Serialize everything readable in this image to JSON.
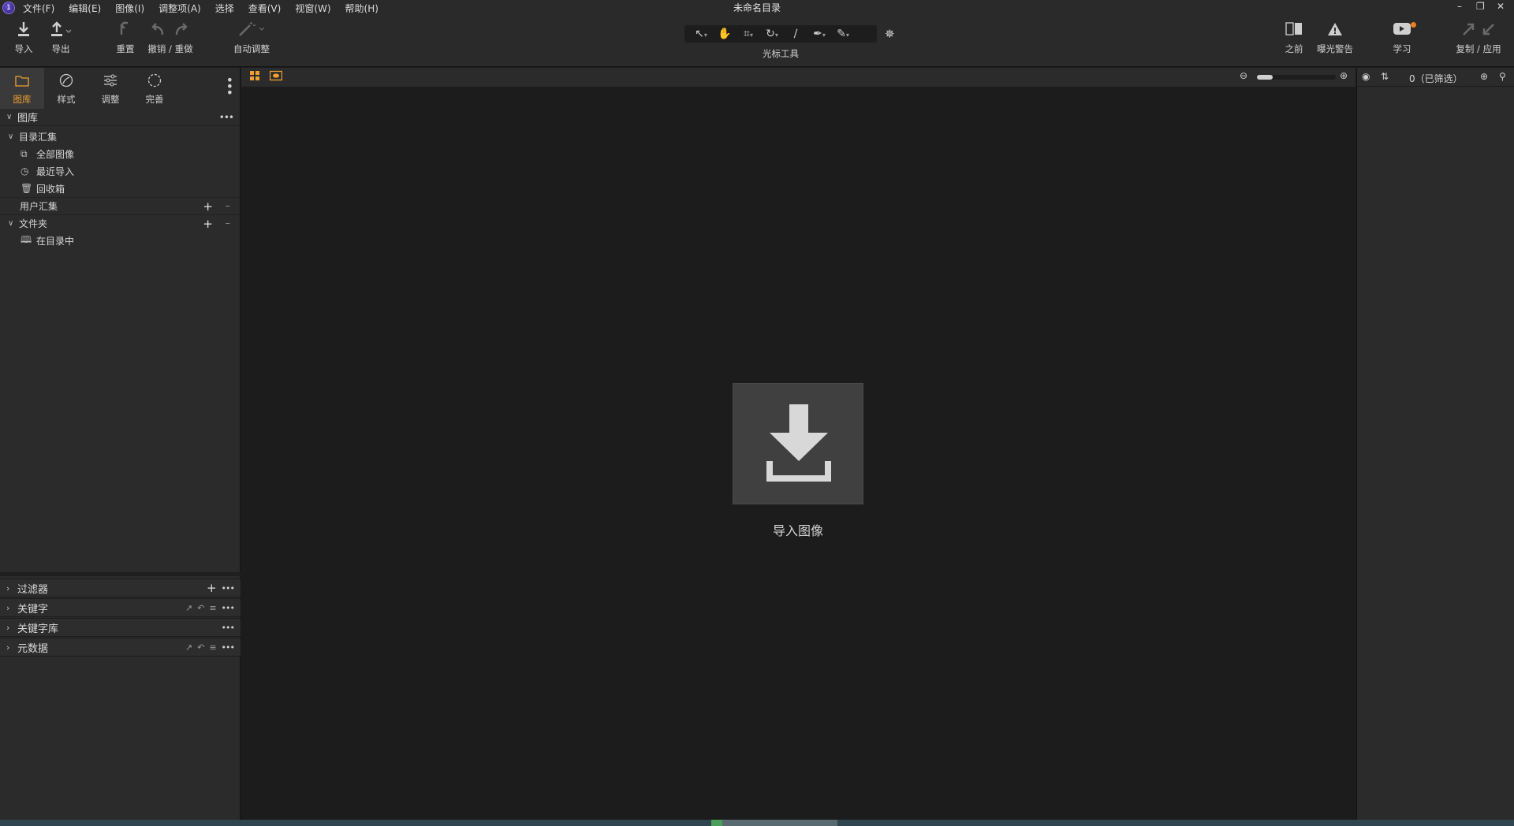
{
  "window": {
    "title": "未命名目录",
    "controls": [
      "–",
      "❐",
      "✕"
    ]
  },
  "menu": [
    "文件(F)",
    "编辑(E)",
    "图像(I)",
    "调整项(A)",
    "选择",
    "查看(V)",
    "视窗(W)",
    "帮助(H)"
  ],
  "toolbar": {
    "import_label": "导入",
    "export_label": "导出",
    "reset_label": "重置",
    "undo_redo_label": "撤销 / 重做",
    "auto_adjust_label": "自动调整",
    "cursor_tools_label": "光标工具",
    "before_label": "之前",
    "exposure_warning_label": "曝光警告",
    "learn_label": "学习",
    "copy_apply_label": "复制 / 应用"
  },
  "left_tabs": [
    {
      "label": "图库",
      "icon": "folder-icon",
      "active": true
    },
    {
      "label": "样式",
      "icon": "styles-icon",
      "active": false
    },
    {
      "label": "调整",
      "icon": "sliders-icon",
      "active": false
    },
    {
      "label": "完善",
      "icon": "refine-icon",
      "active": false
    }
  ],
  "library": {
    "header": "图库",
    "catalog_collections": "目录汇集",
    "all_images": "全部图像",
    "recent_imports": "最近导入",
    "trash": "回收箱",
    "user_collections": "用户汇集",
    "folders": "文件夹",
    "in_catalog": "在目录中"
  },
  "bottom_sections": [
    "过滤器",
    "关键字",
    "关键字库",
    "元数据"
  ],
  "viewer": {
    "import_images_label": "导入图像"
  },
  "browser": {
    "count_label": "0（已筛选）"
  },
  "colors": {
    "accent": "#f0a030",
    "learn_badge": "#f07d1a",
    "status_bar": "#2f4650"
  }
}
